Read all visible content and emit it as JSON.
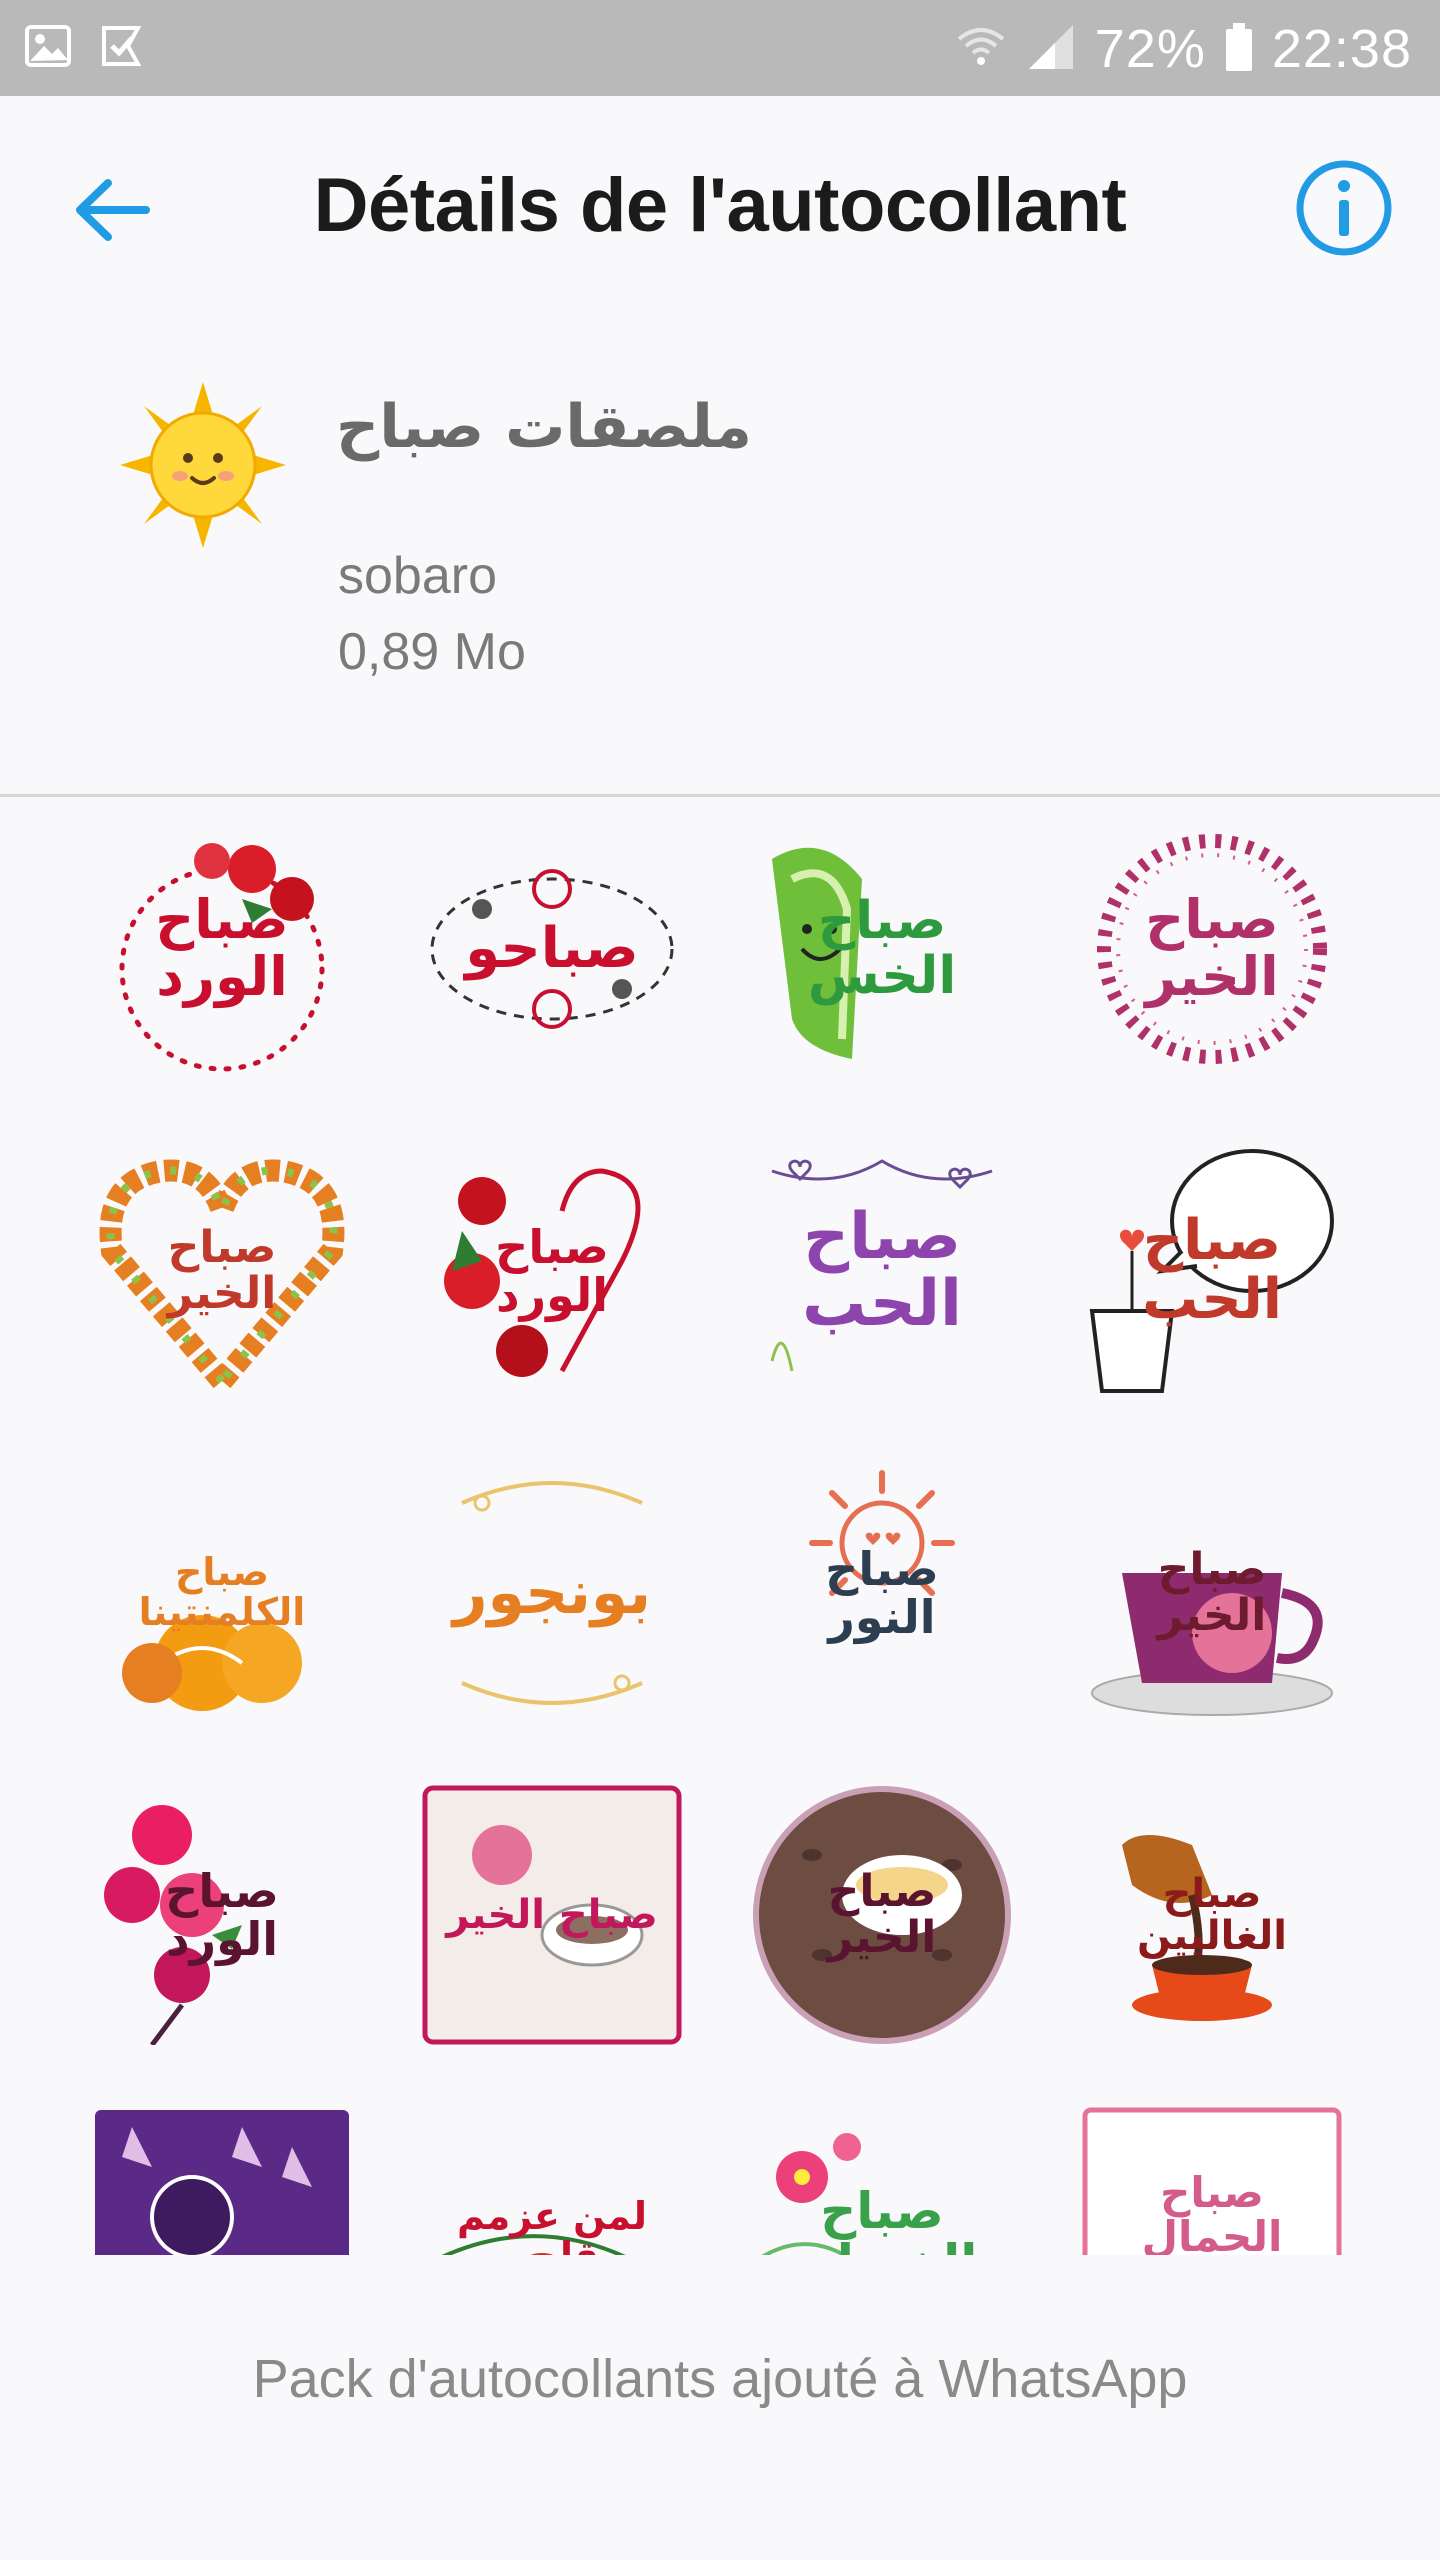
{
  "status_bar": {
    "battery": "72%",
    "time": "22:38"
  },
  "app_bar": {
    "title": "Détails de l'autocollant"
  },
  "pack": {
    "name": "ملصقات صباح",
    "author": "sobaro",
    "size": "0,89 Mo"
  },
  "stickers": [
    {
      "text": "صباح الورد",
      "color": "#c8102e"
    },
    {
      "text": "صباحو",
      "color": "#c8102e"
    },
    {
      "text": "صباح الخس",
      "color": "#2e9a3e"
    },
    {
      "text": "صباح الخير",
      "color": "#b0306a"
    },
    {
      "text": "صباح الخير",
      "color": "#c0392b"
    },
    {
      "text": "صباح الورد",
      "color": "#c8102e"
    },
    {
      "text": "صباح الحب",
      "color": "#8e44ad"
    },
    {
      "text": "صباح الحب",
      "color": "#c0392b"
    },
    {
      "text": "صباح الكلمنتينا",
      "color": "#e67e22"
    },
    {
      "text": "بونجور",
      "color": "#e67e22"
    },
    {
      "text": "صباح النور",
      "color": "#2c3e50"
    },
    {
      "text": "صباح الخير",
      "color": "#6d1b2e"
    },
    {
      "text": "صباح الورد",
      "color": "#5b1430"
    },
    {
      "text": "صباح الخير",
      "color": "#c2185b"
    },
    {
      "text": "صباح الخير",
      "color": "#5b1430"
    },
    {
      "text": "صباح الغاليين",
      "color": "#8b1a1a"
    },
    {
      "text": "",
      "color": "#7b3fa0"
    },
    {
      "text": "لمن عزمم قلبي",
      "color": "#c8102e"
    },
    {
      "text": "صباح الخيرات",
      "color": "#3aa14b"
    },
    {
      "text": "صباح الجمال والطيبة",
      "color": "#d35c8a"
    }
  ],
  "footer": {
    "message": "Pack d'autocollants ajouté à WhatsApp"
  },
  "colors": {
    "accent": "#1f9ce4",
    "status_bar_bg": "#b9b9b9"
  }
}
